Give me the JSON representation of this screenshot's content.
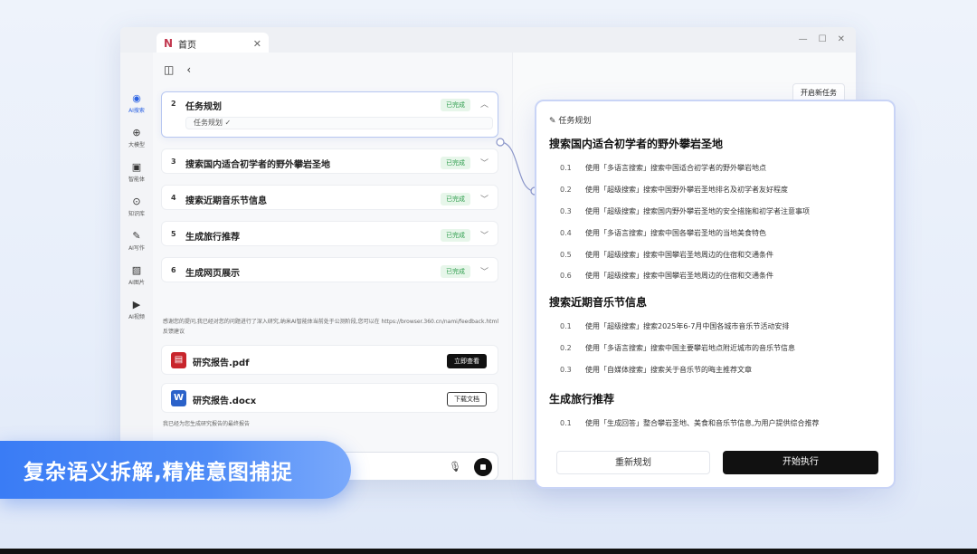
{
  "tab": {
    "title": "首页"
  },
  "rail": [
    {
      "label": "AI搜索",
      "icon": "search-icon"
    },
    {
      "label": "大模型",
      "icon": "model-icon"
    },
    {
      "label": "智能体",
      "icon": "agent-icon"
    },
    {
      "label": "知识库",
      "icon": "knowledge-icon"
    },
    {
      "label": "AI写作",
      "icon": "pen-icon"
    },
    {
      "label": "AI图片",
      "icon": "image-icon"
    },
    {
      "label": "AI视频",
      "icon": "video-icon"
    }
  ],
  "tasks": [
    {
      "num": "2",
      "title": "任务规划",
      "status": "已完成",
      "sub": "任务规划 ✓"
    },
    {
      "num": "3",
      "title": "搜索国内适合初学者的野外攀岩圣地",
      "status": "已完成"
    },
    {
      "num": "4",
      "title": "搜索近期音乐节信息",
      "status": "已完成"
    },
    {
      "num": "5",
      "title": "生成旅行推荐",
      "status": "已完成"
    },
    {
      "num": "6",
      "title": "生成网页展示",
      "status": "已完成"
    }
  ],
  "notice": "感谢您的提问,我已经对您的问题进行了深入研究,纳米AI智能体当前处于公测阶段,您可以在 https://browser.360.cn/nami/feedback.html 反馈建议",
  "files": [
    {
      "name": "研究报告.pdf",
      "action": "立即查看",
      "icon": "pdf-icon",
      "color": "#c8252c"
    },
    {
      "name": "研究报告.docx",
      "action": "下载文档",
      "icon": "word-icon",
      "color": "#2b62c9"
    }
  ],
  "file_note": "我已经为您生成研究报告的最终报告",
  "new_task": "开启新任务",
  "plan": {
    "header": "任务规划",
    "sections": [
      {
        "title": "搜索国内适合初学者的野外攀岩圣地",
        "steps": [
          {
            "n": "0.1",
            "text": "使用「多语言搜索」搜索中国适合初学者的野外攀岩地点"
          },
          {
            "n": "0.2",
            "text": "使用「超级搜索」搜索中国野外攀岩圣地排名及初学者友好程度"
          },
          {
            "n": "0.3",
            "text": "使用「超级搜索」搜索国内野外攀岩圣地的安全措施和初学者注意事项"
          },
          {
            "n": "0.4",
            "text": "使用「多语言搜索」搜索中国各攀岩圣地的当地美食特色"
          },
          {
            "n": "0.5",
            "text": "使用「超级搜索」搜索中国攀岩圣地周边的住宿和交通条件"
          },
          {
            "n": "0.6",
            "text": "使用「超级搜索」搜索中国攀岩圣地周边的住宿和交通条件"
          }
        ]
      },
      {
        "title": "搜索近期音乐节信息",
        "steps": [
          {
            "n": "0.1",
            "text": "使用「超级搜索」搜索2025年6-7月中国各城市音乐节活动安排"
          },
          {
            "n": "0.2",
            "text": "使用「多语言搜索」搜索中国主要攀岩地点附近城市的音乐节信息"
          },
          {
            "n": "0.3",
            "text": "使用「自媒体搜索」搜索关于音乐节的晦主推荐文章"
          }
        ]
      },
      {
        "title": "生成旅行推荐",
        "steps": [
          {
            "n": "0.1",
            "text": "使用「生成回答」整合攀岩圣地、美食和音乐节信息,为用户提供综合推荐"
          }
        ]
      }
    ],
    "replan_label": "重新规划",
    "run_label": "开始执行"
  },
  "banner": "复杂语义拆解,精准意图捕捉",
  "colors": {
    "accent": "#2b62e3",
    "done": "#2f9e4d",
    "banner": "#3a7cf5"
  }
}
